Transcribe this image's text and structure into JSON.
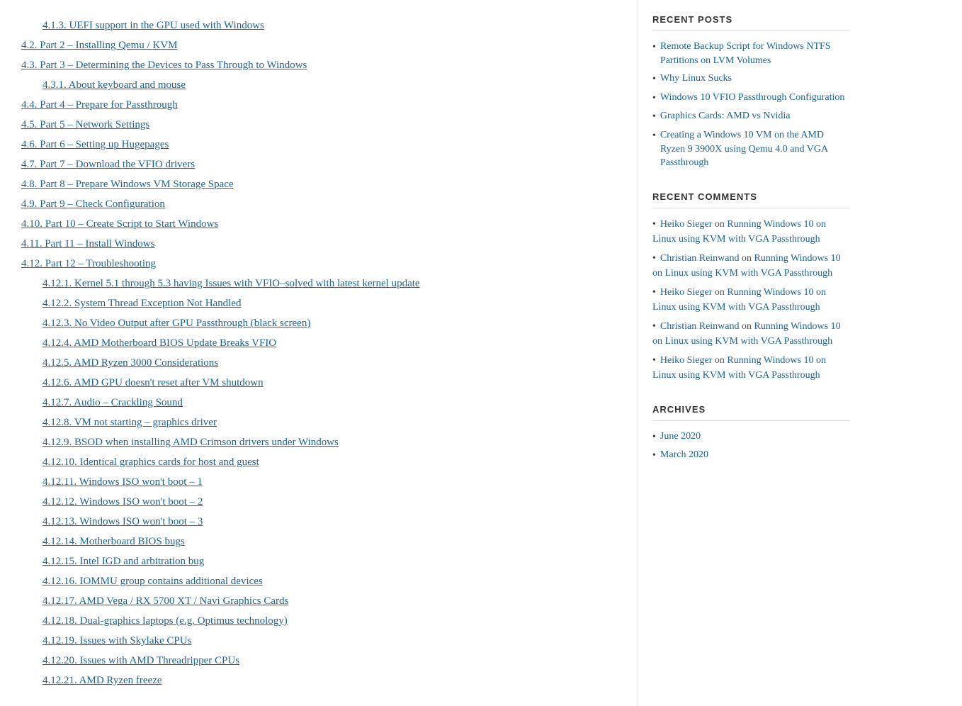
{
  "toc": {
    "items": [
      {
        "id": "t1",
        "label": "4.1.3. UEFI support in the GPU used with Windows",
        "indent": 1
      },
      {
        "id": "t2",
        "label": "4.2. Part 2 – Installing Qemu / KVM",
        "indent": 0
      },
      {
        "id": "t3",
        "label": "4.3. Part 3 – Determining the Devices to Pass Through to Windows",
        "indent": 0
      },
      {
        "id": "t4",
        "label": "4.3.1. About keyboard and mouse",
        "indent": 1
      },
      {
        "id": "t5",
        "label": "4.4. Part 4 – Prepare for Passthrough",
        "indent": 0
      },
      {
        "id": "t6",
        "label": "4.5. Part 5 – Network Settings",
        "indent": 0
      },
      {
        "id": "t7",
        "label": "4.6. Part 6 – Setting up Hugepages",
        "indent": 0
      },
      {
        "id": "t8",
        "label": "4.7. Part 7 – Download the VFIO drivers",
        "indent": 0
      },
      {
        "id": "t9",
        "label": "4.8. Part 8 – Prepare Windows VM Storage Space",
        "indent": 0
      },
      {
        "id": "t10",
        "label": "4.9. Part 9 – Check Configuration",
        "indent": 0
      },
      {
        "id": "t11",
        "label": "4.10. Part 10 – Create Script to Start Windows",
        "indent": 0
      },
      {
        "id": "t12",
        "label": "4.11. Part 11 – Install Windows",
        "indent": 0
      },
      {
        "id": "t13",
        "label": "4.12. Part 12 – Troubleshooting",
        "indent": 0
      },
      {
        "id": "t14",
        "label": "4.12.1. Kernel 5.1 through 5.3 having Issues with VFIO–solved with latest kernel update",
        "indent": 1
      },
      {
        "id": "t15",
        "label": "4.12.2. System Thread Exception Not Handled",
        "indent": 1
      },
      {
        "id": "t16",
        "label": "4.12.3. No Video Output after GPU Passthrough (black screen)",
        "indent": 1
      },
      {
        "id": "t17",
        "label": "4.12.4. AMD Motherboard BIOS Update Breaks VFIO",
        "indent": 1
      },
      {
        "id": "t18",
        "label": "4.12.5. AMD Ryzen 3000 Considerations",
        "indent": 1
      },
      {
        "id": "t19",
        "label": "4.12.6. AMD GPU doesn't reset after VM shutdown",
        "indent": 1
      },
      {
        "id": "t20",
        "label": "4.12.7. Audio – Crackling Sound",
        "indent": 1
      },
      {
        "id": "t21",
        "label": "4.12.8. VM not starting – graphics driver",
        "indent": 1
      },
      {
        "id": "t22",
        "label": "4.12.9. BSOD when installing AMD Crimson drivers under Windows",
        "indent": 1
      },
      {
        "id": "t23",
        "label": "4.12.10. Identical graphics cards for host and guest",
        "indent": 1
      },
      {
        "id": "t24",
        "label": "4.12.11. Windows ISO won't boot – 1",
        "indent": 1
      },
      {
        "id": "t25",
        "label": "4.12.12. Windows ISO won't boot – 2",
        "indent": 1
      },
      {
        "id": "t26",
        "label": "4.12.13. Windows ISO won't boot – 3",
        "indent": 1
      },
      {
        "id": "t27",
        "label": "4.12.14. Motherboard BIOS bugs",
        "indent": 1
      },
      {
        "id": "t28",
        "label": "4.12.15. Intel IGD and arbitration bug",
        "indent": 1
      },
      {
        "id": "t29",
        "label": "4.12.16. IOMMU group contains additional devices",
        "indent": 1
      },
      {
        "id": "t30",
        "label": "4.12.17. AMD Vega / RX 5700 XT / Navi Graphics Cards",
        "indent": 1
      },
      {
        "id": "t31",
        "label": "4.12.18. Dual-graphics laptops (e.g. Optimus technology)",
        "indent": 1
      },
      {
        "id": "t32",
        "label": "4.12.19. Issues with Skylake CPUs",
        "indent": 1
      },
      {
        "id": "t33",
        "label": "4.12.20. Issues with AMD Threadripper CPUs",
        "indent": 1
      },
      {
        "id": "t34",
        "label": "4.12.21. AMD Ryzen freeze",
        "indent": 1
      }
    ]
  },
  "sidebar": {
    "recent_posts": {
      "heading": "Recent Posts",
      "items": [
        {
          "label": "Remote Backup Script for Windows NTFS Partitions on LVM Volumes"
        },
        {
          "label": "Why Linux Sucks"
        },
        {
          "label": "Windows 10 VFIO Passthrough Configuration"
        },
        {
          "label": "Graphics Cards: AMD vs Nvidia"
        },
        {
          "label": "Creating a Windows 10 VM on the AMD Ryzen 9 3900X using Qemu 4.0 and VGA Passthrough"
        }
      ]
    },
    "recent_comments": {
      "heading": "Recent Comments",
      "items": [
        {
          "commenter": "Heiko Sieger",
          "on_text": "on",
          "link_label": "Running Windows 10 on Linux using KVM with VGA Passthrough"
        },
        {
          "commenter": "Christian Reinwand",
          "on_text": "on",
          "link_label": "Running Windows 10 on Linux using KVM with VGA Passthrough"
        },
        {
          "commenter": "Heiko Sieger",
          "on_text": "on",
          "link_label": "Running Windows 10 on Linux using KVM with VGA Passthrough"
        },
        {
          "commenter": "Christian Reinwand",
          "on_text": "on",
          "link_label": "Running Windows 10 on Linux using KVM with VGA Passthrough"
        },
        {
          "commenter": "Heiko Sieger",
          "on_text": "on",
          "link_label": "Running Windows 10 on Linux using KVM with VGA Passthrough"
        }
      ]
    },
    "archives": {
      "heading": "Archives",
      "items": [
        {
          "label": "June 2020"
        },
        {
          "label": "March 2020"
        }
      ]
    }
  }
}
